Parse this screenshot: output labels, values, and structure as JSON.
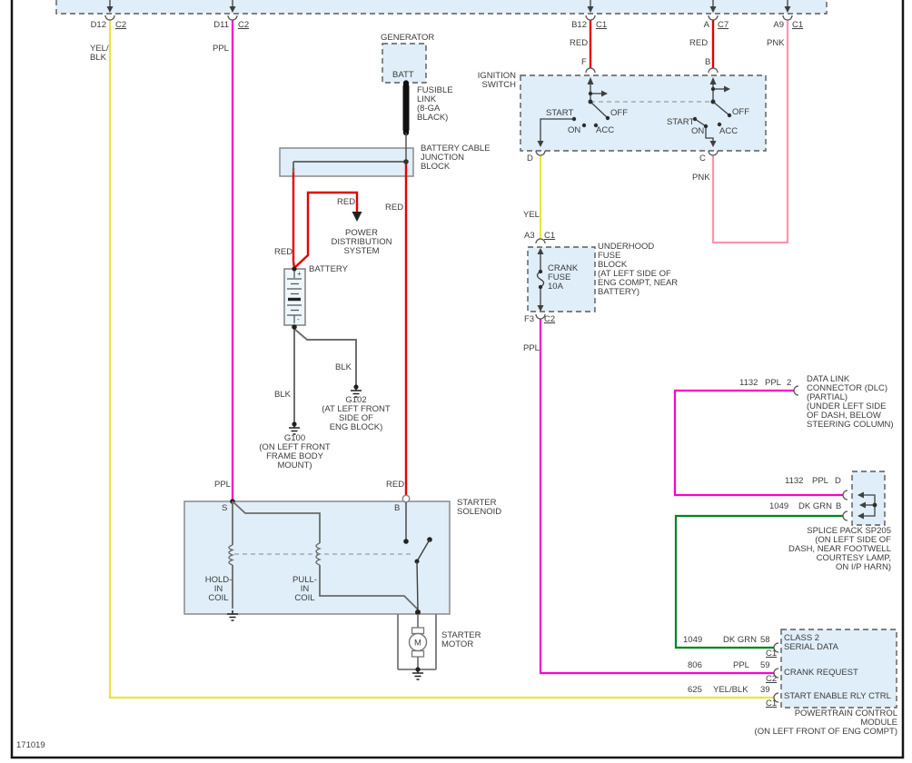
{
  "page": {
    "drawing_id": "171019"
  },
  "colors": {
    "red": "#e60000",
    "yellow": "#e8e53f",
    "purple": "#ff00cc",
    "pink": "#ff94b0",
    "green": "#00851f",
    "gray_wire": "#6e6e6e",
    "box_fill": "#dfeef8"
  },
  "top_pins": [
    {
      "pin": "D12",
      "conn": "C2",
      "wire": "YEL/\nBLK"
    },
    {
      "pin": "D11",
      "conn": "C2",
      "wire": "PPL"
    },
    {
      "pin": "B12",
      "conn": "C1",
      "wire": "RED"
    },
    {
      "pin": "A",
      "conn": "C7",
      "wire": "RED"
    },
    {
      "pin": "A9",
      "conn": "C1",
      "wire": "PNK"
    }
  ],
  "generator": {
    "title": "GENERATOR",
    "terminal": "BATT"
  },
  "fusible_link": "FUSIBLE\nLINK\n(8-GA\nBLACK)",
  "junction_block": "BATTERY CABLE\nJUNCTION\nBLOCK",
  "power_dist": {
    "wire": "RED",
    "label": "POWER\nDISTRIBUTION\nSYSTEM"
  },
  "battery": {
    "title": "BATTERY",
    "wire_in": "RED",
    "plus": "+",
    "minus": "-"
  },
  "ground_g100": {
    "wire": "BLK",
    "label": "G100\n(ON LEFT FRONT\nFRAME BODY\nMOUNT)"
  },
  "ground_g102": {
    "wire": "BLK",
    "label": "G102\n(AT LEFT FRONT\nSIDE OF\nENG BLOCK)"
  },
  "ignition": {
    "title": "IGNITION\nSWITCH",
    "pin_f": "F",
    "pin_b": "B",
    "pin_d": "D",
    "pin_c": "C",
    "positions": [
      "START",
      "ON",
      "ACC",
      "OFF"
    ],
    "wire_d": "YEL",
    "wire_c": "PNK"
  },
  "fuse_block": {
    "pin_top": "A3",
    "conn_top": "C1",
    "fuse": "CRANK\nFUSE\n10A",
    "label": "UNDERHOOD\nFUSE\nBLOCK\n(AT LEFT SIDE OF\nENG COMPT, NEAR\nBATTERY)",
    "pin_bottom": "F3",
    "conn_bottom": "C2",
    "wire_out": "PPL"
  },
  "solenoid": {
    "title": "STARTER\nSOLENOID",
    "pin_s": "S",
    "pin_b": "B",
    "wire_s": "PPL",
    "wire_b": "RED",
    "hold_coil": "HOLD-\nIN\nCOIL",
    "pull_coil": "PULL-\nIN\nCOIL"
  },
  "starter_motor": {
    "title": "STARTER\nMOTOR",
    "symbol": "M"
  },
  "dlc": {
    "circuit": "1132",
    "color": "PPL",
    "pin": "2",
    "label": "DATA LINK\nCONNECTOR (DLC)\n(PARTIAL)\n(UNDER LEFT SIDE\nOF DASH, BELOW\nSTEERING COLUMN)"
  },
  "splice": {
    "row_d": {
      "circuit": "1132",
      "color": "PPL",
      "pin": "D"
    },
    "row_b": {
      "circuit": "1049",
      "color": "DK GRN",
      "pin": "B"
    },
    "label": "SPLICE PACK SP205\n(ON LEFT SIDE OF\nDASH, NEAR FOOTWELL\nCOURTESY LAMP,\nON I/P HARN)"
  },
  "pcm": {
    "rows": [
      {
        "circuit": "1049",
        "color": "DK GRN",
        "pin": "58",
        "conn": "C1",
        "signal": "CLASS 2\nSERIAL DATA"
      },
      {
        "circuit": "806",
        "color": "PPL",
        "pin": "59",
        "conn": "C2",
        "signal": "CRANK REQUEST"
      },
      {
        "circuit": "625",
        "color": "YEL/BLK",
        "pin": "39",
        "conn": "C1",
        "signal": "START ENABLE RLY CTRL"
      }
    ],
    "label": "POWERTRAIN CONTROL\nMODULE\n(ON LEFT FRONT OF ENG COMPT)"
  }
}
